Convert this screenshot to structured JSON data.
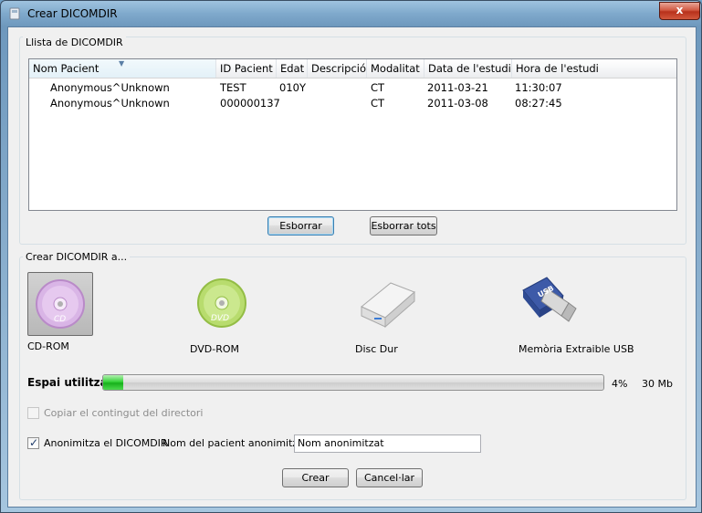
{
  "window": {
    "title": "Crear DICOMDIR",
    "close_label": "x"
  },
  "list_group": {
    "title": "Llista de DICOMDIR",
    "columns": [
      "Nom Pacient",
      "ID Pacient",
      "Edat",
      "Descripció",
      "Modalitat",
      "Data de l'estudi",
      "Hora de l'estudi"
    ],
    "rows": [
      [
        "Anonymous^Unknown",
        "TEST",
        "010Y",
        "",
        "CT",
        "2011-03-21",
        "11:30:07"
      ],
      [
        "Anonymous^Unknown",
        "000000137",
        "",
        "",
        "CT",
        "2011-03-08",
        "08:27:45"
      ]
    ],
    "delete_label": "Esborrar",
    "delete_all_label": "Esborrar tots"
  },
  "create_group": {
    "title": "Crear DICOMDIR a...",
    "destinations": [
      {
        "label": "CD-ROM",
        "icon": "cd-icon",
        "selected": true
      },
      {
        "label": "DVD-ROM",
        "icon": "dvd-icon",
        "selected": false
      },
      {
        "label": "Disc Dur",
        "icon": "hard-disk-icon",
        "selected": false
      },
      {
        "label": "Memòria Extraible USB",
        "icon": "usb-icon",
        "selected": false
      }
    ],
    "space_label": "Espai utilitzat",
    "space_percent_text": "4%",
    "space_percent": 4,
    "space_size": "30 Mb",
    "copy_dir_label": "Copiar el contingut del directori",
    "copy_dir_checked": false,
    "anonymize_label": "Anonimitza el DICOMDIR",
    "anonymize_checked": true,
    "anon_name_label": "Nom del pacient anonimitzat:",
    "anon_name_value": "Nom anonimitzat",
    "create_label": "Crear",
    "cancel_label": "Cancel·lar"
  },
  "colors": {
    "accent": "#3c7fb1",
    "progress": "#17b01b",
    "close": "#c4402a"
  }
}
